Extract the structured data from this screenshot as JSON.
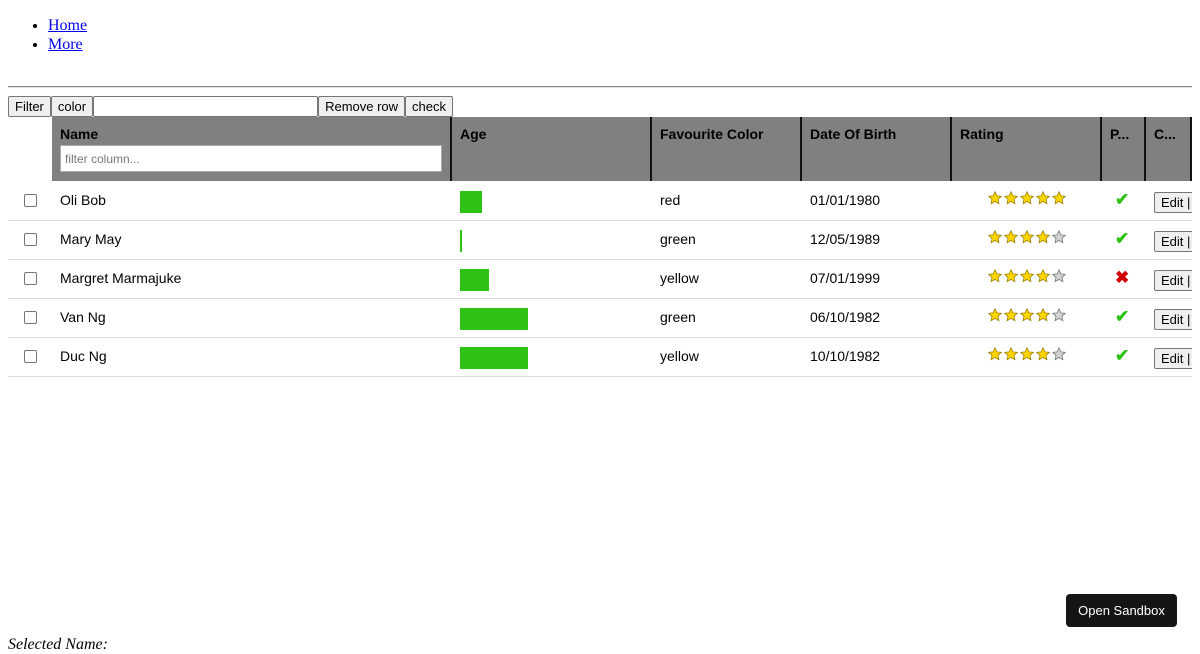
{
  "nav": {
    "links": [
      {
        "label": "Home"
      },
      {
        "label": "More"
      }
    ]
  },
  "toolbar": {
    "filter_label": "Filter",
    "field_label": "color",
    "value_input": "",
    "remove_label": "Remove row",
    "check_label": "check"
  },
  "table": {
    "headers": {
      "name": "Name",
      "age": "Age",
      "color": "Favourite Color",
      "dob": "Date Of Birth",
      "rating": "Rating",
      "p": "P...",
      "c": "C..."
    },
    "filter_placeholder": "filter column...",
    "rows": [
      {
        "name": "Oli Bob",
        "age_fraction": 0.16,
        "color": "red",
        "dob": "01/01/1980",
        "rating": 5,
        "passed": true,
        "edit_label": "Edit |"
      },
      {
        "name": "Mary May",
        "age_fraction": 0.01,
        "color": "green",
        "dob": "12/05/1989",
        "rating": 4,
        "passed": true,
        "edit_label": "Edit |"
      },
      {
        "name": "Margret Marmajuke",
        "age_fraction": 0.21,
        "color": "yellow",
        "dob": "07/01/1999",
        "rating": 4,
        "passed": false,
        "edit_label": "Edit |"
      },
      {
        "name": "Van Ng",
        "age_fraction": 0.5,
        "color": "green",
        "dob": "06/10/1982",
        "rating": 4,
        "passed": true,
        "edit_label": "Edit |"
      },
      {
        "name": "Duc Ng",
        "age_fraction": 0.5,
        "color": "yellow",
        "dob": "10/10/1982",
        "rating": 4,
        "passed": true,
        "edit_label": "Edit |"
      }
    ],
    "max_stars": 5,
    "bar_color": "#2dc214",
    "star_on_color": "#ffd500",
    "star_off_color": "#d2d2d2",
    "header_bg": "#808080",
    "pass_icon": "check-icon",
    "fail_icon": "cross-icon"
  },
  "sandbox": {
    "label": "Open Sandbox"
  },
  "footer": {
    "selected_text": "Selected Name:"
  }
}
